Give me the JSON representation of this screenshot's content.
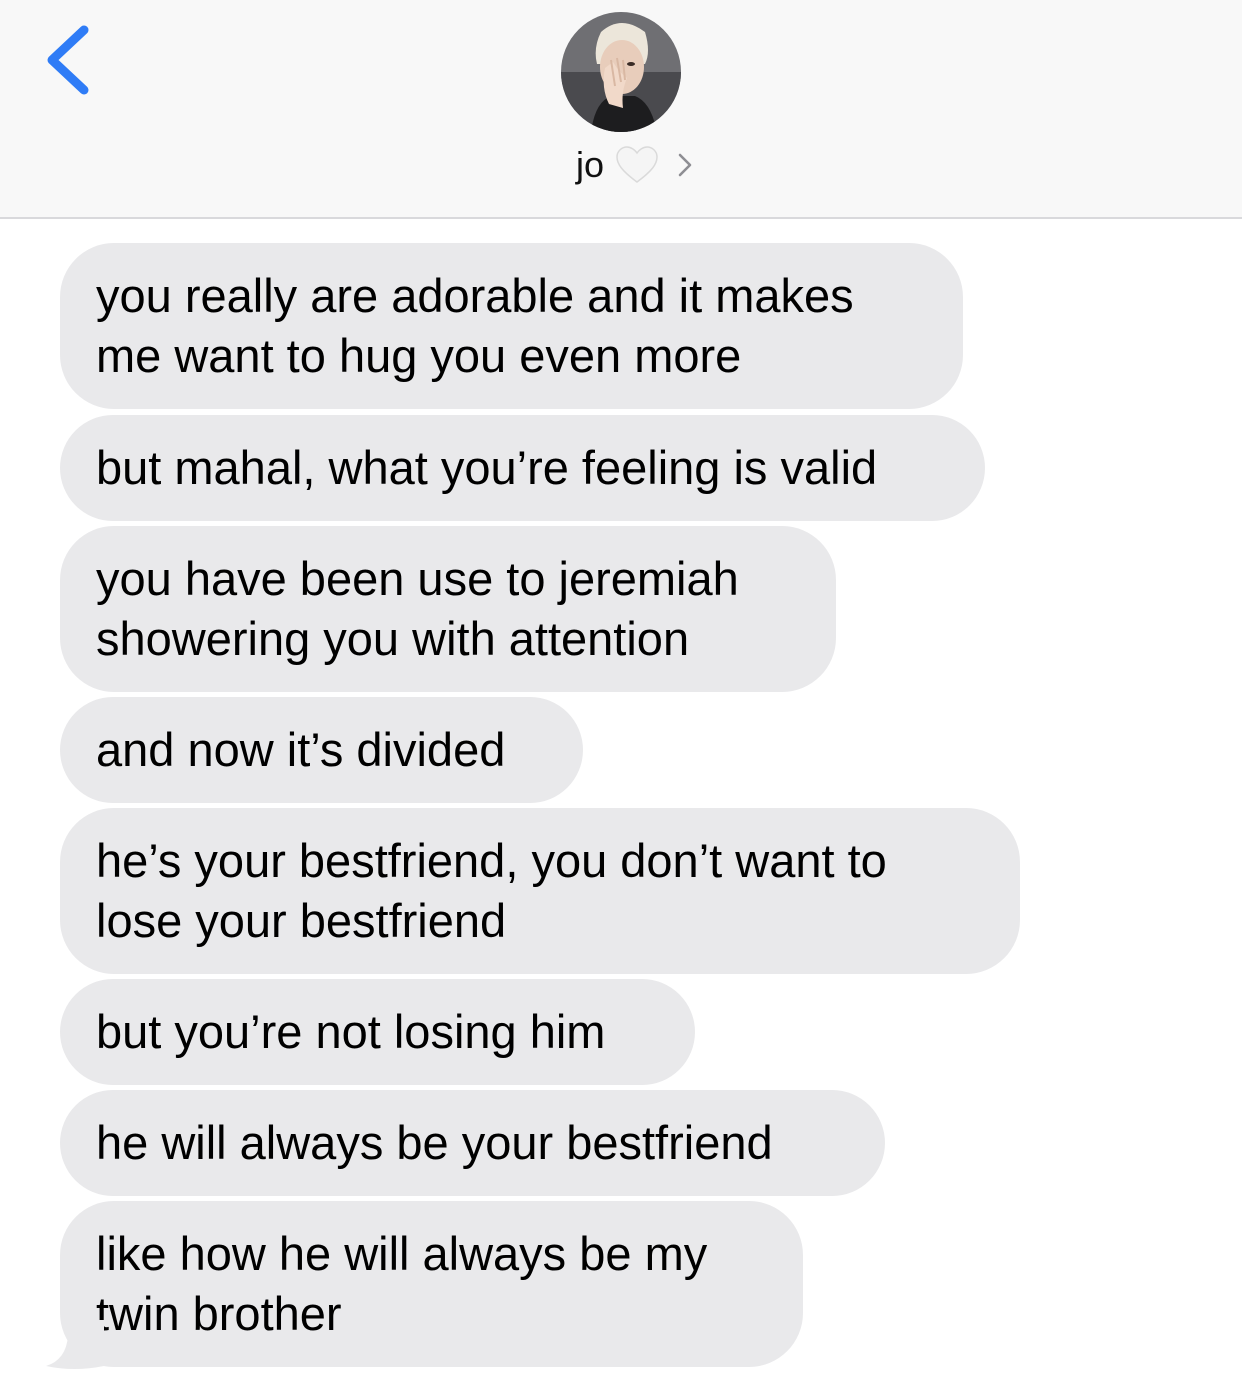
{
  "header": {
    "contact_name": "jo",
    "back_icon": "chevron-left-icon",
    "heart_icon": "white-heart-icon",
    "details_icon": "chevron-right-icon",
    "accent_color": "#2f7cf6"
  },
  "messages": [
    {
      "text": "you really are adorable and it makes\nme want to hug you even more",
      "direction": "incoming"
    },
    {
      "text": "but mahal, what you’re feeling is valid",
      "direction": "incoming"
    },
    {
      "text": "you have been use to jeremiah\nshowering you with attention",
      "direction": "incoming"
    },
    {
      "text": "and now it’s divided",
      "direction": "incoming"
    },
    {
      "text": "he’s your bestfriend, you don’t want to\nlose your bestfriend",
      "direction": "incoming"
    },
    {
      "text": "but you’re not losing him",
      "direction": "incoming"
    },
    {
      "text": "he will always be your bestfriend",
      "direction": "incoming"
    },
    {
      "text": "like how he will always be my\ntwin brother",
      "direction": "incoming"
    }
  ],
  "colors": {
    "bubble_incoming": "#e9e9eb",
    "header_bg": "#f8f8f8"
  }
}
